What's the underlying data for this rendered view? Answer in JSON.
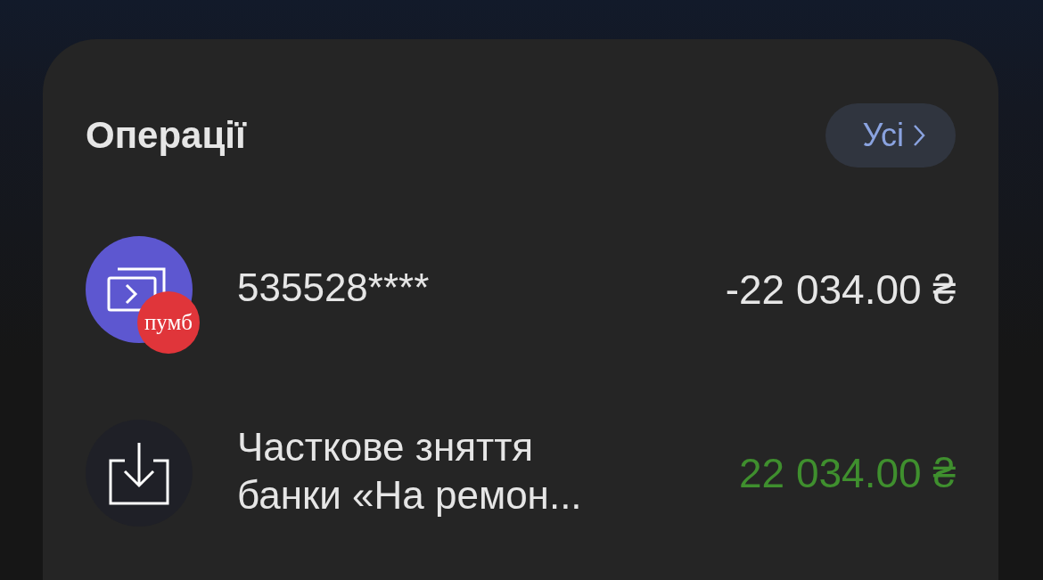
{
  "section": {
    "title": "Операції",
    "all_button": "Усі"
  },
  "operations": [
    {
      "kind": "transfer",
      "title": "535528****",
      "badge": "пумб",
      "amount": "-22 034.00 ₴"
    },
    {
      "kind": "withdrawal",
      "title": "Часткове зняття банки «На ремон...",
      "amount": "22 034.00 ₴"
    }
  ]
}
